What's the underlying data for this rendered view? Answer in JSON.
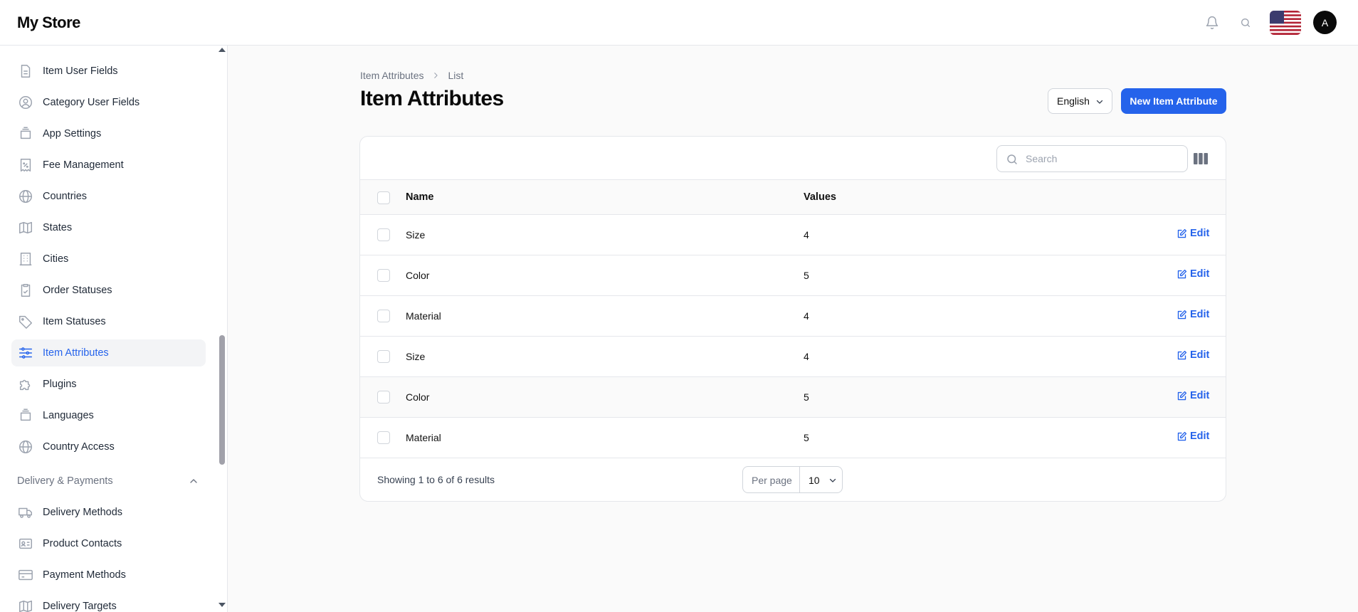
{
  "brand": "My Store",
  "colors": {
    "accent": "#2563eb",
    "text": "#111111",
    "muted": "#6b7280"
  },
  "header": {
    "icons": [
      "bell-icon",
      "search-icon",
      "us-flag-icon"
    ],
    "avatar_initial": "A"
  },
  "sidebar": {
    "items": [
      {
        "label": "Item User Fields",
        "icon": "document-icon"
      },
      {
        "label": "Category User Fields",
        "icon": "user-circle-icon"
      },
      {
        "label": "App Settings",
        "icon": "stack-icon"
      },
      {
        "label": "Fee Management",
        "icon": "receipt-percent-icon"
      },
      {
        "label": "Countries",
        "icon": "globe-icon"
      },
      {
        "label": "States",
        "icon": "map-icon"
      },
      {
        "label": "Cities",
        "icon": "building-icon"
      },
      {
        "label": "Order Statuses",
        "icon": "clipboard-check-icon"
      },
      {
        "label": "Item Statuses",
        "icon": "tag-icon"
      },
      {
        "label": "Item Attributes",
        "icon": "sliders-icon",
        "active": true
      },
      {
        "label": "Plugins",
        "icon": "puzzle-icon"
      },
      {
        "label": "Languages",
        "icon": "stack-icon"
      },
      {
        "label": "Country Access",
        "icon": "globe-icon"
      }
    ],
    "section": {
      "label": "Delivery & Payments",
      "expanded": true
    },
    "section_items": [
      {
        "label": "Delivery Methods",
        "icon": "truck-icon"
      },
      {
        "label": "Product Contacts",
        "icon": "id-card-icon"
      },
      {
        "label": "Payment Methods",
        "icon": "credit-card-icon"
      },
      {
        "label": "Delivery Targets",
        "icon": "map-icon"
      }
    ]
  },
  "breadcrumb": {
    "parent": "Item Attributes",
    "current": "List"
  },
  "page": {
    "title": "Item Attributes",
    "language": "English",
    "new_button": "New Item Attribute"
  },
  "table": {
    "search_placeholder": "Search",
    "columns": {
      "name": "Name",
      "values": "Values"
    },
    "edit_label": "Edit",
    "rows": [
      {
        "name": "Size",
        "values": "4"
      },
      {
        "name": "Color",
        "values": "5"
      },
      {
        "name": "Material",
        "values": "4"
      },
      {
        "name": "Size",
        "values": "4"
      },
      {
        "name": "Color",
        "values": "5"
      },
      {
        "name": "Material",
        "values": "5"
      }
    ],
    "summary": "Showing 1 to 6 of 6 results",
    "per_page_label": "Per page",
    "per_page_value": "10"
  }
}
